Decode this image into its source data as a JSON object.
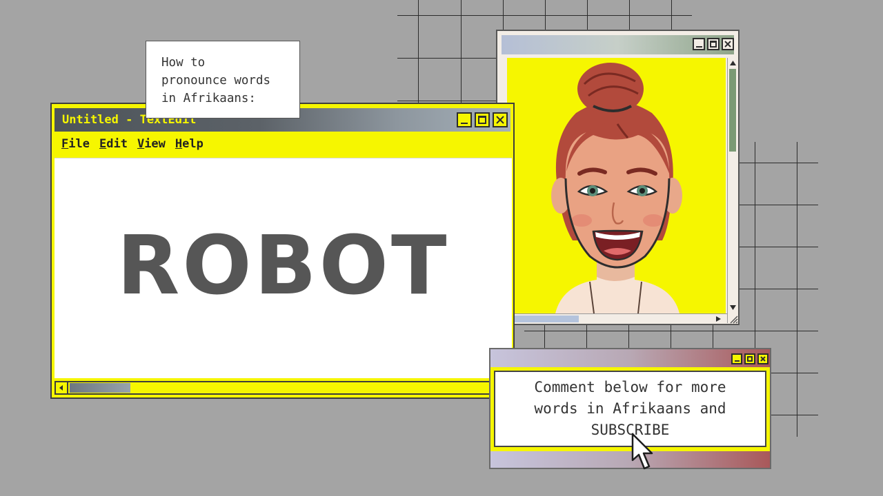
{
  "caption": {
    "lines": [
      "How to",
      "pronounce words",
      "in Afrikaans:"
    ]
  },
  "editor": {
    "title": "Untitled - TextEdit",
    "menu": [
      {
        "key": "F",
        "rest": "ile"
      },
      {
        "key": "E",
        "rest": "dit"
      },
      {
        "key": "V",
        "rest": "iew"
      },
      {
        "key": "H",
        "rest": "elp"
      }
    ],
    "word": "ROBOT"
  },
  "subscribe": {
    "lines": [
      "Comment below for more",
      "words in Afrikaans and",
      "SUBSCRIBE"
    ]
  },
  "colors": {
    "background": "#a4a4a4",
    "accent_yellow": "#f6f600",
    "word": "#565656"
  },
  "icons": [
    "minimize-icon",
    "maximize-icon",
    "close-icon",
    "scroll-left-arrow-icon",
    "scroll-up-arrow-icon",
    "scroll-down-arrow-icon",
    "scroll-right-arrow-icon",
    "resize-grip-icon",
    "mouse-pointer-icon"
  ]
}
